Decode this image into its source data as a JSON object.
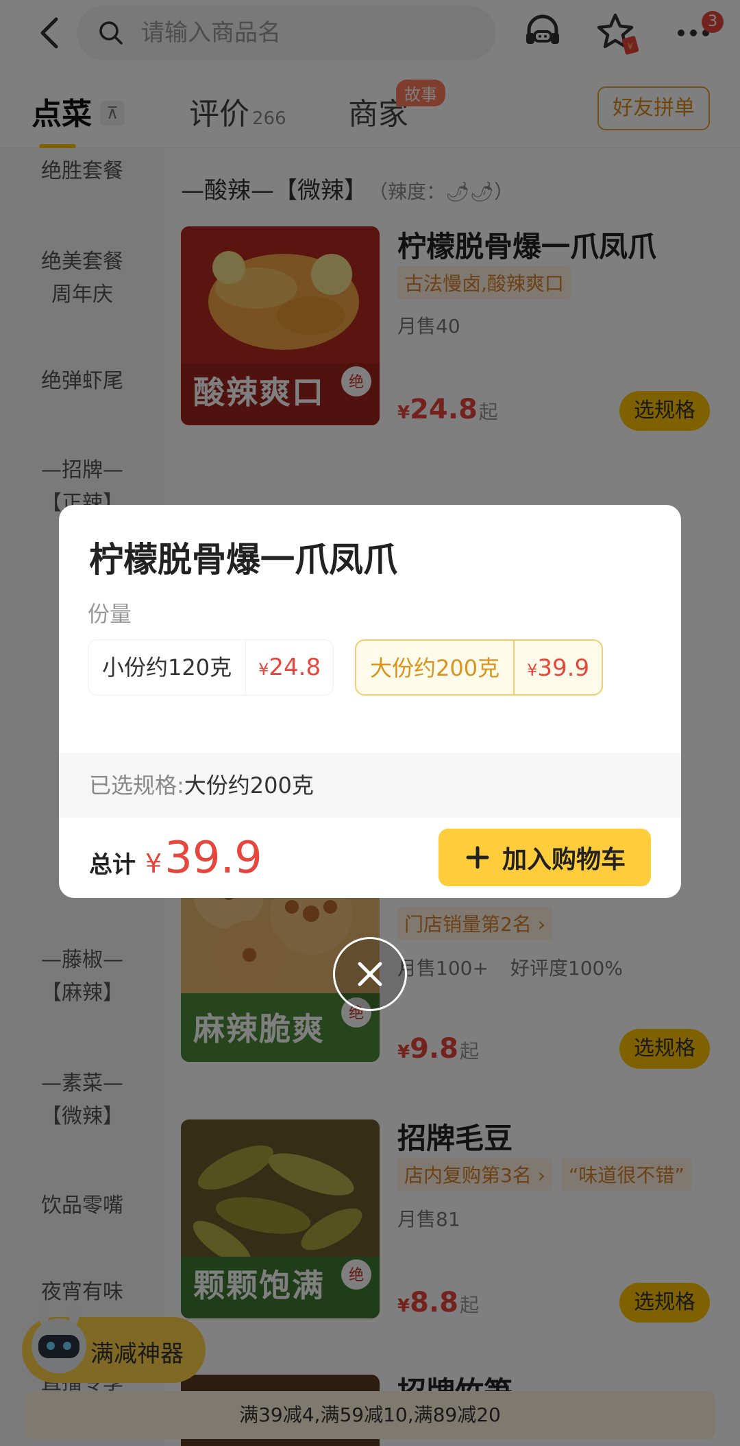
{
  "search": {
    "placeholder": "请输入商品名"
  },
  "cart_badge": "3",
  "tabs": {
    "order": "点菜",
    "pin_glyph": "⊼",
    "reviews": "评价",
    "reviews_count": "266",
    "merchant": "商家",
    "story_badge": "故事",
    "group_order": "好友拼单"
  },
  "categories": [
    "绝胜套餐",
    "绝美套餐\n周年庆",
    "绝弹虾尾",
    "—招牌—\n【正辣】",
    "—藤椒—\n【麻辣】",
    "—素菜—\n【微辣】",
    "饮品零嘴",
    "夜宵有味",
    "直播专享"
  ],
  "list": {
    "section1": {
      "title": "—酸辣—【微辣】",
      "level": "（辣度：🌶🌶）"
    },
    "products": [
      {
        "name": "柠檬脱骨爆一爪凤爪",
        "tags": [
          "古法慢卤,酸辣爽口"
        ],
        "sales": "月售40",
        "price_symbol": "¥",
        "price": "24.8",
        "suffix": "起",
        "button": "选规格",
        "image_caption": "酸辣爽口",
        "stamp": "绝"
      },
      {
        "name": "",
        "tags": [
          "门店销量第2名 ›"
        ],
        "sales": "月售100+",
        "rating": "好评度100%",
        "price_symbol": "¥",
        "price": "9.8",
        "suffix": "起",
        "button": "选规格",
        "image_caption": "麻辣脆爽",
        "stamp": "绝"
      },
      {
        "name": "招牌毛豆",
        "tags": [
          "店内复购第3名 ›",
          "“味道很不错”"
        ],
        "sales": "月售81",
        "price_symbol": "¥",
        "price": "8.8",
        "suffix": "起",
        "button": "选规格",
        "image_caption": "颗颗饱满",
        "stamp": "绝"
      },
      {
        "name": "招牌竹笋"
      }
    ]
  },
  "manjian": {
    "label": "满减神器"
  },
  "promo": "满39减4,满59减10,满89减20",
  "modal": {
    "title": "柠檬脱骨爆一爪凤爪",
    "spec_label": "份量",
    "options": [
      {
        "name": "小份约120克",
        "price_symbol": "¥",
        "price": "24.8",
        "selected": false
      },
      {
        "name": "大份约200克",
        "price_symbol": "¥",
        "price": "39.9",
        "selected": true
      }
    ],
    "selected_label": "已选规格:",
    "selected_value": "大份约200克",
    "total_label": "总计",
    "total_symbol": "¥",
    "total_value": "39.9",
    "add_cart_label": "加入购物车"
  },
  "colors": {
    "accent": "#ffc300",
    "price_red": "#e8453c",
    "tag_orange": "#d9822b"
  }
}
